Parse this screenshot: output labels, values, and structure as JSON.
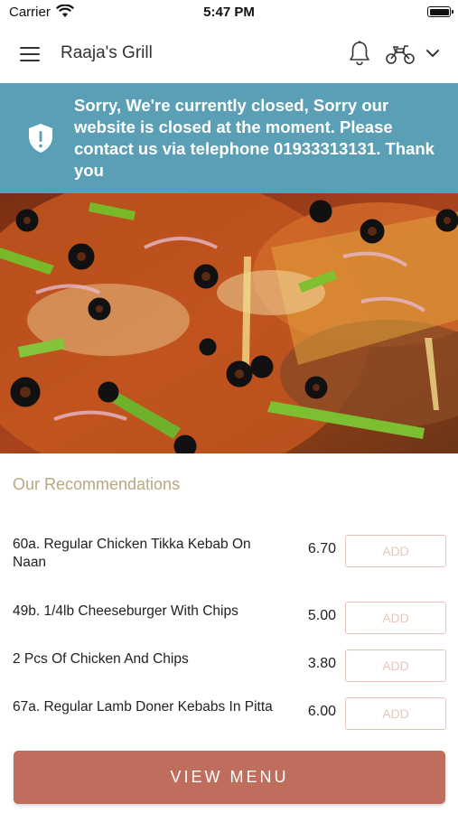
{
  "status_bar": {
    "carrier": "Carrier",
    "time": "5:47 PM"
  },
  "header": {
    "title": "Raaja's Grill",
    "icons": [
      "menu-icon",
      "bell-icon",
      "delivery-bike-icon",
      "chevron-down-icon"
    ]
  },
  "notice": {
    "icon": "shield-icon",
    "message": "Sorry, We're currently closed, Sorry our website is closed at the moment. Please contact us via telephone 01933313131. Thank you",
    "color": "#5a9fb6"
  },
  "hero": {
    "image": "pizza-photo"
  },
  "recommendations": {
    "title": "Our Recommendations",
    "items": [
      {
        "name": "60a. Regular Chicken Tikka Kebab On Naan",
        "price": "6.70",
        "button": "ADD"
      },
      {
        "name": "49b. 1/4lb Cheeseburger With Chips",
        "price": "5.00",
        "button": "ADD"
      },
      {
        "name": "2 Pcs Of Chicken And Chips",
        "price": "3.80",
        "button": "ADD"
      },
      {
        "name": "67a. Regular Lamb Doner Kebabs In Pitta",
        "price": "6.00",
        "button": "ADD"
      }
    ]
  },
  "view_menu": {
    "label": "VIEW MENU",
    "color": "#bf6e5d"
  }
}
